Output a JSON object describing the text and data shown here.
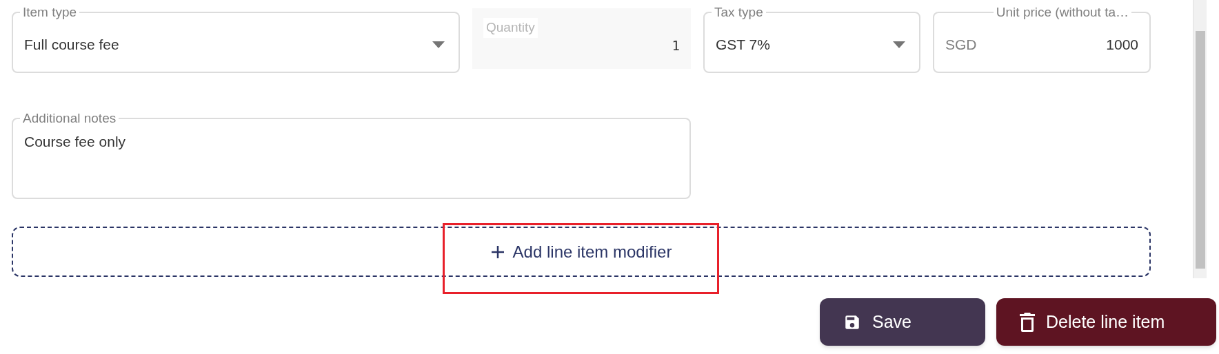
{
  "fields": [
    {
      "kind": "select",
      "label": "Item type",
      "value": "Full course fee",
      "disabled": false
    },
    {
      "kind": "number",
      "label": "Quantity",
      "value": "1",
      "disabled": true
    },
    {
      "kind": "select",
      "label": "Tax type",
      "value": "GST 7%",
      "disabled": false
    },
    {
      "kind": "currency",
      "label": "Unit price (without ta…",
      "prefix": "SGD",
      "value": "1000",
      "disabled": false
    }
  ],
  "notes": {
    "label": "Additional notes",
    "value": "Course fee only"
  },
  "add_modifier": {
    "label": "Add line item modifier",
    "highlighted": true
  },
  "buttons": [
    {
      "kind": "save",
      "label": "Save"
    },
    {
      "kind": "delete",
      "label": "Delete line item"
    }
  ]
}
